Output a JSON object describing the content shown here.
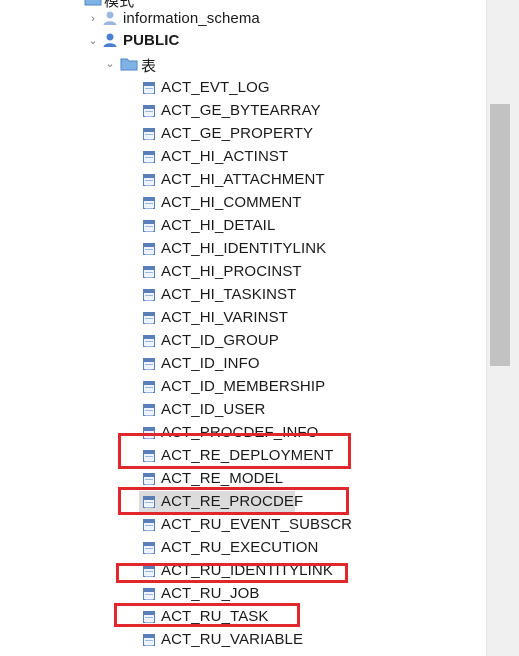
{
  "tree": {
    "parent_partial": "模式",
    "schemas": [
      {
        "label": "information_schema",
        "expanded": false
      },
      {
        "label": "PUBLIC",
        "expanded": true
      }
    ],
    "folder": {
      "label": "表",
      "expanded": true
    },
    "tables": [
      "ACT_EVT_LOG",
      "ACT_GE_BYTEARRAY",
      "ACT_GE_PROPERTY",
      "ACT_HI_ACTINST",
      "ACT_HI_ATTACHMENT",
      "ACT_HI_COMMENT",
      "ACT_HI_DETAIL",
      "ACT_HI_IDENTITYLINK",
      "ACT_HI_PROCINST",
      "ACT_HI_TASKINST",
      "ACT_HI_VARINST",
      "ACT_ID_GROUP",
      "ACT_ID_INFO",
      "ACT_ID_MEMBERSHIP",
      "ACT_ID_USER",
      "ACT_PROCDEF_INFO",
      "ACT_RE_DEPLOYMENT",
      "ACT_RE_MODEL",
      "ACT_RE_PROCDEF",
      "ACT_RU_EVENT_SUBSCR",
      "ACT_RU_EXECUTION",
      "ACT_RU_IDENTITYLINK",
      "ACT_RU_JOB",
      "ACT_RU_TASK",
      "ACT_RU_VARIABLE"
    ],
    "selected_table": "ACT_RE_PROCDEF",
    "highlighted_tables": [
      "ACT_RE_DEPLOYMENT",
      "ACT_RE_PROCDEF",
      "ACT_RU_IDENTITYLINK",
      "ACT_RU_TASK"
    ]
  },
  "colors": {
    "highlight_box": "#e0282c",
    "selection": "#dcdcdc",
    "schema_icon": "#4a7fd0",
    "folder_icon": "#7fb2e5"
  }
}
